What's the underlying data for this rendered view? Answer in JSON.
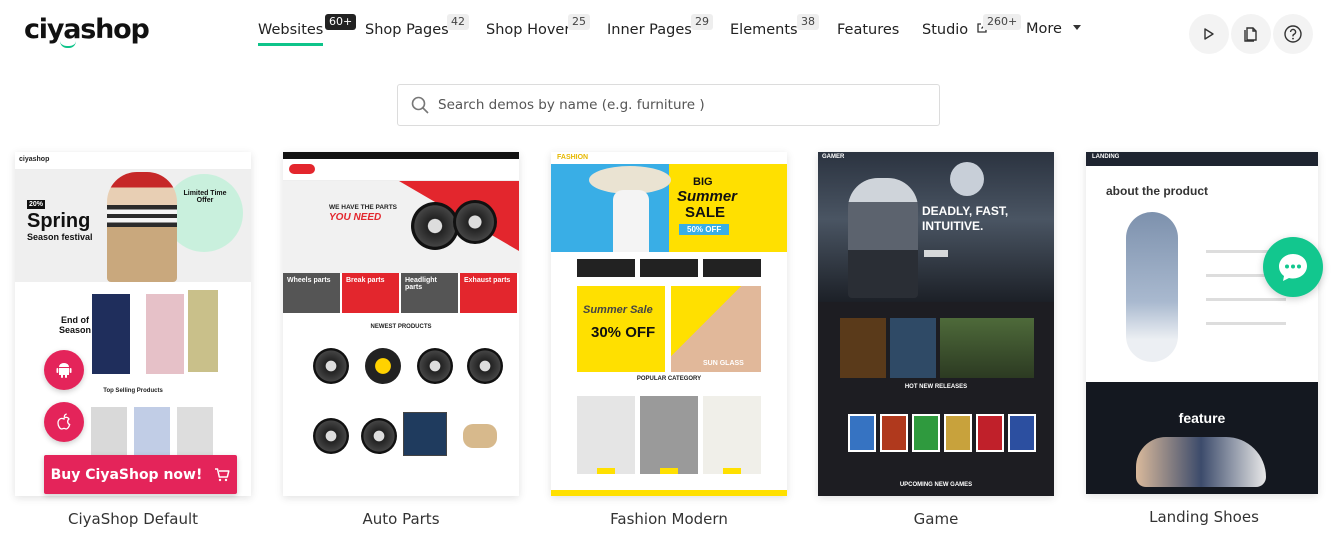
{
  "brand": {
    "logo_text": "ciyashop"
  },
  "nav": {
    "items": [
      {
        "label": "Websites",
        "badge": "60+",
        "active": true
      },
      {
        "label": "Shop Pages",
        "badge": "42"
      },
      {
        "label": "Shop Hover",
        "badge": "25"
      },
      {
        "label": "Inner Pages",
        "badge": "29"
      },
      {
        "label": "Elements",
        "badge": "38"
      },
      {
        "label": "Features"
      },
      {
        "label": "Studio",
        "badge": "260+"
      },
      {
        "label": "More"
      }
    ]
  },
  "header_actions": {
    "icons": [
      "play-icon",
      "document-icon",
      "help-icon"
    ]
  },
  "search": {
    "placeholder": "Search demos by name (e.g. furniture )"
  },
  "demos": [
    {
      "title": "CiyaShop Default",
      "thumb_text": {
        "logo": "ciyashop",
        "sale": "20%",
        "headline": "Spring",
        "sub": "Season festival",
        "offer": "Limited Time Offer",
        "eos": "End of Season",
        "section": "Top Selling Products"
      }
    },
    {
      "title": "Auto Parts",
      "thumb_text": {
        "line1": "WE HAVE THE PARTS",
        "line2": "YOU NEED",
        "tiles": [
          "Wheels parts",
          "Break parts",
          "Headlight parts",
          "Exhaust parts"
        ],
        "section": "NEWEST PRODUCTS"
      }
    },
    {
      "title": "Fashion Modern",
      "thumb_text": {
        "logo": "FASHION",
        "big": "BIG",
        "summer": "Summer",
        "sale": "SALE",
        "off": "50% OFF",
        "promo_title": "Summer Sale",
        "promo_off": "30% OFF",
        "glass": "SUN GLASS",
        "category": "POPULAR CATEGORY"
      }
    },
    {
      "title": "Game",
      "thumb_text": {
        "logo": "GAMER",
        "headline": "DEADLY, FAST, INTUITIVE.",
        "section1": "HOT NEW RELEASES",
        "section2": "UPCOMING NEW GAMES"
      }
    },
    {
      "title": "Landing Shoes",
      "thumb_text": {
        "logo": "LANDING",
        "heading": "about the product",
        "feature": "feature"
      }
    }
  ],
  "floating": {
    "android_icon": "android-icon",
    "apple_icon": "apple-icon",
    "buy_label": "Buy CiyaShop now!",
    "chat_icon": "chat-icon"
  },
  "colors": {
    "accent_green": "#0ec48a",
    "buy_pink": "#e4245a",
    "chat_green": "#12c78e"
  }
}
